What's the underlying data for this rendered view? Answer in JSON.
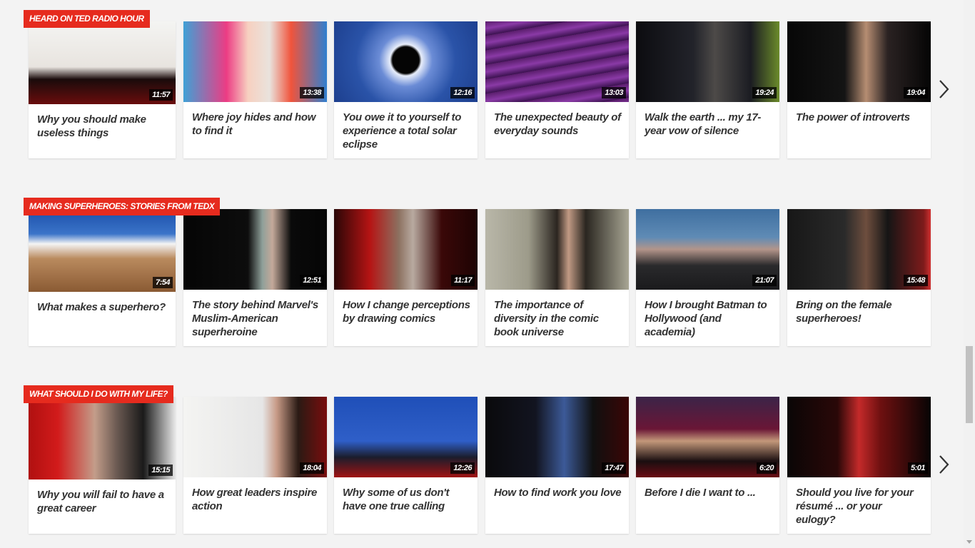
{
  "rows": [
    {
      "label": "HEARD ON TED RADIO HOUR",
      "has_next": true,
      "talks": [
        {
          "title": "Why you should make useless things",
          "duration": "11:57",
          "bg": "linear-gradient(180deg,#f4f4f2 0%,#e8e4df 55%,#1a0b0b 70%,#6a0d0d 100%)"
        },
        {
          "title": "Where joy hides and how to find it",
          "duration": "13:38",
          "bg": "linear-gradient(90deg,#3fa1d6 0%,#ec3c84 30%,#f7d0c0 45%,#e9e3dd 60%,#f0543c 75%,#2f7fd0 100%)"
        },
        {
          "title": "You owe it to yourself to experience a total solar eclipse",
          "duration": "12:16",
          "bg": "radial-gradient(circle at 50% 48%,#050505 0%,#050505 16%,#e8eefb 19%,#6b8cd6 32%,#2a53a8 60%,#1d3f8e 100%)"
        },
        {
          "title": "The unexpected beauty of everyday sounds",
          "duration": "13:03",
          "bg": "repeating-linear-gradient(170deg,#5a1e6c 0px,#8a3aa6 10px,#3c1250 20px)"
        },
        {
          "title": "Walk the earth ... my 17-year vow of silence",
          "duration": "19:24",
          "bg": "linear-gradient(90deg,#0c0c10 0%,#22232a 40%,#4d4a48 55%,#1b1c22 80%,#6b8b2a 100%)"
        },
        {
          "title": "The power of introverts",
          "duration": "19:04",
          "bg": "linear-gradient(90deg,#070707 0%,#141414 40%,#b68d72 55%,#2a2222 70%,#050505 100%)"
        }
      ]
    },
    {
      "label": "MAKING SUPERHEROES: STORIES FROM TEDX",
      "has_next": false,
      "talks": [
        {
          "title": "What makes a superhero?",
          "duration": "7:54",
          "bg": "linear-gradient(180deg,#1a4ea8 0%,#3b74c9 30%,#f4f4f4 42%,#b98a5e 60%,#8a5a33 100%)"
        },
        {
          "title": "The story behind Marvel's Muslim-American superheroine",
          "duration": "12:51",
          "bg": "linear-gradient(90deg,#050505 0%,#0d0d0d 45%,#8fa09a 55%,#c4a99a 62%,#0a0a0a 75%,#050505 100%)"
        },
        {
          "title": "How I change perceptions by drawing comics",
          "duration": "11:17",
          "bg": "linear-gradient(90deg,#2a0606 0%,#b51414 25%,#8c7060 45%,#b8aaa0 55%,#3a0808 75%,#1d0303 100%)"
        },
        {
          "title": "The importance of diversity in the comic book universe",
          "duration": "",
          "bg": "linear-gradient(90deg,#b9b7a9 0%,#9d9b8a 30%,#2b2520 50%,#c19a84 58%,#2a2620 70%,#a8a694 100%)"
        },
        {
          "title": "How I brought Batman to Hollywood (and academia)",
          "duration": "21:07",
          "bg": "linear-gradient(180deg,#3f6fa0 0%,#5f8bb5 35%,#b3958a 50%,#2a2a2c 70%,#1a1a1c 100%)"
        },
        {
          "title": "Bring on the female superheroes!",
          "duration": "15:48",
          "bg": "linear-gradient(90deg,#171717 0%,#2a2a2a 40%,#6e4e3e 55%,#151515 70%,#7d1b1b 95%,#d03030 100%)"
        }
      ]
    },
    {
      "label": "WHAT SHOULD I DO WITH MY LIFE?",
      "has_next": true,
      "talks": [
        {
          "title": "Why you will fail to have a great career",
          "duration": "15:15",
          "bg": "linear-gradient(90deg,#b01010 0%,#d21b1b 20%,#c39d8a 45%,#6b5a52 60%,#1a1a1a 78%,#e8e8e8 100%)"
        },
        {
          "title": "How great leaders inspire action",
          "duration": "18:04",
          "bg": "linear-gradient(90deg,#f4f4f2 0%,#e6e6e6 55%,#c79a86 65%,#2a1a14 80%,#7a0d0d 100%)"
        },
        {
          "title": "Why some of us don't have one true calling",
          "duration": "12:26",
          "bg": "linear-gradient(180deg,#1f4fb8 0%,#2f5fc8 55%,#1b1d2c 75%,#a01212 100%)"
        },
        {
          "title": "How to find work you love",
          "duration": "17:47",
          "bg": "linear-gradient(90deg,#0a0a0c 0%,#121420 35%,#3c5a98 55%,#101010 75%,#3a0606 100%)"
        },
        {
          "title": "Before I die I want to ...",
          "duration": "6:20",
          "bg": "linear-gradient(180deg,#3b2448 0%,#6a1636 40%,#c3987a 55%,#1a0e10 80%,#6a0c14 100%)"
        },
        {
          "title": "Should you live for your résumé ... or your eulogy?",
          "duration": "5:01",
          "bg": "linear-gradient(90deg,#0a0606 0%,#2a0808 35%,#c42a2a 50%,#6e1010 65%,#070404 100%)"
        }
      ]
    }
  ]
}
